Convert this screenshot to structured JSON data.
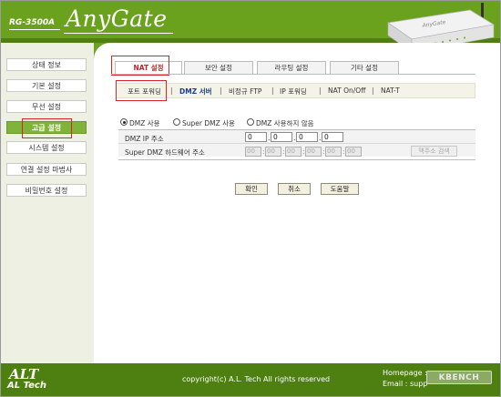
{
  "header": {
    "model": "RG-3500A",
    "brand": "AnyGate",
    "router_label": "AnyGate"
  },
  "sidebar": {
    "items": [
      {
        "label": "상태 정보"
      },
      {
        "label": "기본 설정"
      },
      {
        "label": "무선 설정"
      },
      {
        "label": "고급 설정",
        "active": true
      },
      {
        "label": "시스템 설정"
      },
      {
        "label": "연결 설정 마법사"
      },
      {
        "label": "비밀번호 설정"
      }
    ]
  },
  "tabs": [
    {
      "label": "NAT 설정",
      "active": true
    },
    {
      "label": "보안 설정"
    },
    {
      "label": "라우팅 설정"
    },
    {
      "label": "기타 설정"
    }
  ],
  "subnav": {
    "items": [
      {
        "label": "포트 포워딩"
      },
      {
        "label": "DMZ 서버",
        "active": true
      },
      {
        "label": "비정규 FTP"
      },
      {
        "label": "IP 포워딩"
      },
      {
        "label": "NAT On/Off"
      },
      {
        "label": "NAT-T"
      }
    ],
    "separator": "|"
  },
  "dmz": {
    "options": [
      {
        "label": "DMZ 사용",
        "checked": true
      },
      {
        "label": "Super DMZ 사용",
        "checked": false
      },
      {
        "label": "DMZ 사용하지 않음",
        "checked": false
      }
    ],
    "ip_label": "DMZ IP 주소",
    "ip_octets": [
      "0",
      "0",
      "0",
      "0"
    ],
    "ip_separator": ".",
    "mac_label": "Super DMZ 하드웨어 주소",
    "mac_octets": [
      "00",
      "00",
      "00",
      "00",
      "00",
      "00"
    ],
    "mac_separator": ":",
    "mac_search_button": "맥주소 검색"
  },
  "buttons": {
    "confirm": "확인",
    "cancel": "취소",
    "help": "도움말"
  },
  "footer": {
    "logo_symbol": "ALT",
    "logo_text": "AL Tech",
    "copyright": "copyright(c) A.L. Tech All rights reserved",
    "homepage": "Homepage : ",
    "email": "Email : supp",
    "watermark": "KBENCH"
  },
  "colors": {
    "brand_green": "#6ba21d",
    "footer_green": "#4e7f11",
    "highlight_red": "#d9242a",
    "active_tab_text": "#c8202a",
    "active_subnav_text": "#1b3d8f"
  }
}
